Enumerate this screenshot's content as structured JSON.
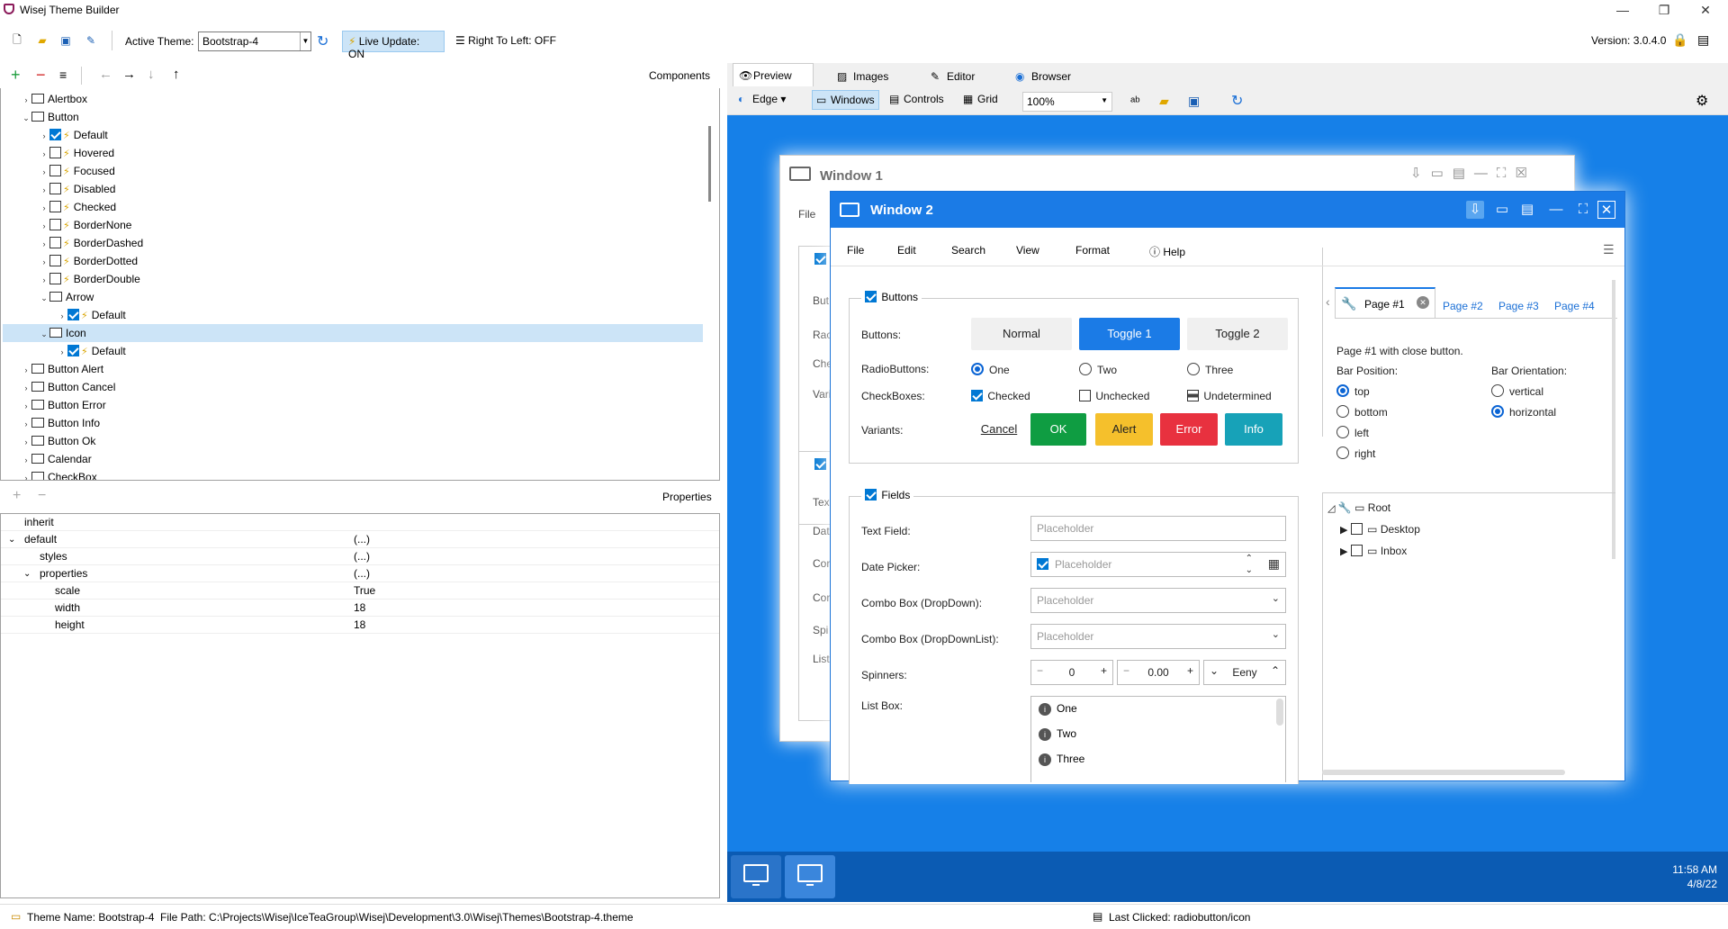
{
  "app": {
    "title": "Wisej Theme Builder"
  },
  "toolbar": {
    "active_theme_label": "Active Theme:",
    "active_theme_value": "Bootstrap-4",
    "live_update": "Live Update: ON",
    "right_to_left": "Right To Left: OFF",
    "version": "Version: 3.0.4.0"
  },
  "components": {
    "header": "Components",
    "tree": [
      {
        "label": "Alertbox",
        "level": 0,
        "expanded": false,
        "check": null
      },
      {
        "label": "Button",
        "level": 0,
        "expanded": true,
        "check": null
      },
      {
        "label": "Default",
        "level": 1,
        "expanded": false,
        "check": true
      },
      {
        "label": "Hovered",
        "level": 1,
        "expanded": false,
        "check": false
      },
      {
        "label": "Focused",
        "level": 1,
        "expanded": false,
        "check": false
      },
      {
        "label": "Disabled",
        "level": 1,
        "expanded": false,
        "check": false
      },
      {
        "label": "Checked",
        "level": 1,
        "expanded": false,
        "check": false
      },
      {
        "label": "BorderNone",
        "level": 1,
        "expanded": false,
        "check": false
      },
      {
        "label": "BorderDashed",
        "level": 1,
        "expanded": false,
        "check": false
      },
      {
        "label": "BorderDotted",
        "level": 1,
        "expanded": false,
        "check": false
      },
      {
        "label": "BorderDouble",
        "level": 1,
        "expanded": false,
        "check": false
      },
      {
        "label": "Arrow",
        "level": 1,
        "expanded": true,
        "check": null
      },
      {
        "label": "Default",
        "level": 2,
        "expanded": false,
        "check": true
      },
      {
        "label": "Icon",
        "level": 1,
        "expanded": true,
        "check": null,
        "selected": true
      },
      {
        "label": "Default",
        "level": 2,
        "expanded": false,
        "check": true
      },
      {
        "label": "Button Alert",
        "level": 0,
        "expanded": false,
        "check": null
      },
      {
        "label": "Button Cancel",
        "level": 0,
        "expanded": false,
        "check": null
      },
      {
        "label": "Button Error",
        "level": 0,
        "expanded": false,
        "check": null
      },
      {
        "label": "Button Info",
        "level": 0,
        "expanded": false,
        "check": null
      },
      {
        "label": "Button Ok",
        "level": 0,
        "expanded": false,
        "check": null
      },
      {
        "label": "Calendar",
        "level": 0,
        "expanded": false,
        "check": null
      },
      {
        "label": "CheckBox",
        "level": 0,
        "expanded": false,
        "check": null
      }
    ]
  },
  "properties": {
    "header": "Properties",
    "rows": [
      {
        "key": "inherit",
        "value": "",
        "level": 0,
        "exp": ""
      },
      {
        "key": "default",
        "value": "(...)",
        "level": 0,
        "exp": "v"
      },
      {
        "key": "styles",
        "value": "(...)",
        "level": 1,
        "exp": ""
      },
      {
        "key": "properties",
        "value": "(...)",
        "level": 1,
        "exp": "v"
      },
      {
        "key": "scale",
        "value": "True",
        "level": 2,
        "exp": ""
      },
      {
        "key": "width",
        "value": "18",
        "level": 2,
        "exp": ""
      },
      {
        "key": "height",
        "value": "18",
        "level": 2,
        "exp": ""
      }
    ]
  },
  "status": {
    "theme": "Theme Name: Bootstrap-4",
    "path": "File Path: C:\\Projects\\Wisej\\IceTeaGroup\\Wisej\\Development\\3.0\\Wisej\\Themes\\Bootstrap-4.theme",
    "last_clicked": "Last Clicked: radiobutton/icon"
  },
  "preview": {
    "tabs": [
      "Preview",
      "Images",
      "Editor",
      "Browser"
    ],
    "browser": "Edge",
    "view_windows": "Windows",
    "view_controls": "Controls",
    "view_grid": "Grid",
    "zoom": "100%"
  },
  "win1": {
    "title": "Window 1",
    "menu_file": "File"
  },
  "win2": {
    "title": "Window 2",
    "menu": [
      "File",
      "Edit",
      "Search",
      "View",
      "Format",
      "Help"
    ],
    "buttons_group": "Buttons",
    "buttons_label": "Buttons:",
    "btn_normal": "Normal",
    "btn_toggle1": "Toggle 1",
    "btn_toggle2": "Toggle 2",
    "radio_label": "RadioButtons:",
    "radio": [
      "One",
      "Two",
      "Three"
    ],
    "check_label": "CheckBoxes:",
    "checks": [
      "Checked",
      "Unchecked",
      "Undetermined"
    ],
    "variants_label": "Variants:",
    "variants": {
      "cancel": "Cancel",
      "ok": "OK",
      "alert": "Alert",
      "error": "Error",
      "info": "Info"
    },
    "fields_group": "Fields",
    "text_field": "Text Field:",
    "date_picker": "Date Picker:",
    "combo1": "Combo Box (DropDown):",
    "combo2": "Combo Box (DropDownList):",
    "spinners": "Spinners:",
    "listbox": "List Box:",
    "placeholder": "Placeholder",
    "spin1": "0",
    "spin2": "0.00",
    "spin3": "Eeny",
    "list": [
      "One",
      "Two",
      "Three"
    ],
    "pages": [
      "Page #1",
      "Page #2",
      "Page #3",
      "Page #4"
    ],
    "page_text": "Page #1 with close button.",
    "bar_position": "Bar Position:",
    "bar_orientation": "Bar Orientation:",
    "positions": [
      "top",
      "bottom",
      "left",
      "right"
    ],
    "orientations": [
      "vertical",
      "horizontal"
    ],
    "tree": [
      "Root",
      "Desktop",
      "Inbox"
    ]
  },
  "partial_win1_labels": [
    "But",
    "Rac",
    "Che",
    "Vari",
    "Tex",
    "Dat",
    "Cor",
    "Cor",
    "Spi",
    "List"
  ],
  "clock": {
    "time": "11:58 AM",
    "date": "4/8/22"
  },
  "colors": {
    "accent": "#1b7be6",
    "ok": "#0f9d42",
    "alert": "#f5c02c",
    "error": "#e8313f",
    "info": "#17a2b8",
    "desktop": "#1680e8"
  }
}
